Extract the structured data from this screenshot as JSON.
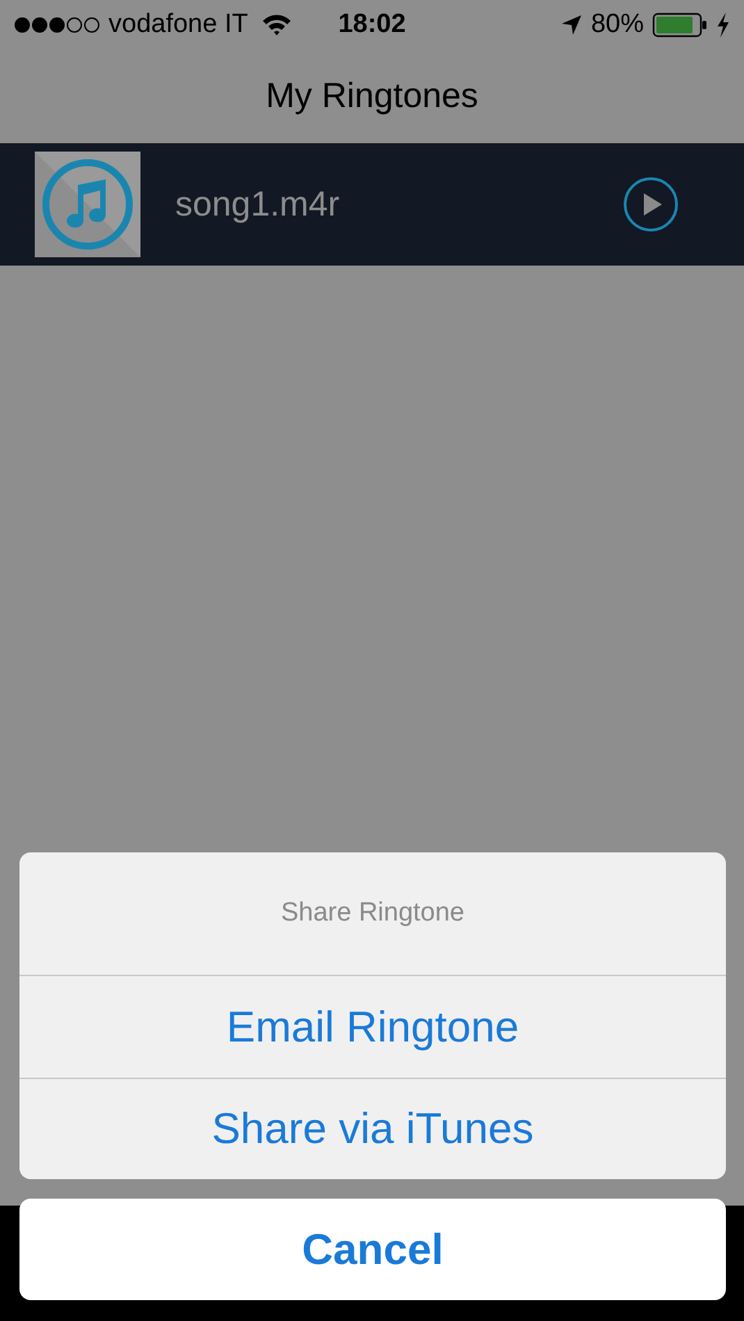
{
  "status_bar": {
    "carrier": "vodafone IT",
    "time": "18:02",
    "battery_text": "80%"
  },
  "nav": {
    "title": "My Ringtones"
  },
  "ringtones": [
    {
      "name": "song1.m4r"
    }
  ],
  "action_sheet": {
    "title": "Share Ringtone",
    "actions": [
      "Email Ringtone",
      "Share via iTunes"
    ],
    "cancel": "Cancel"
  }
}
